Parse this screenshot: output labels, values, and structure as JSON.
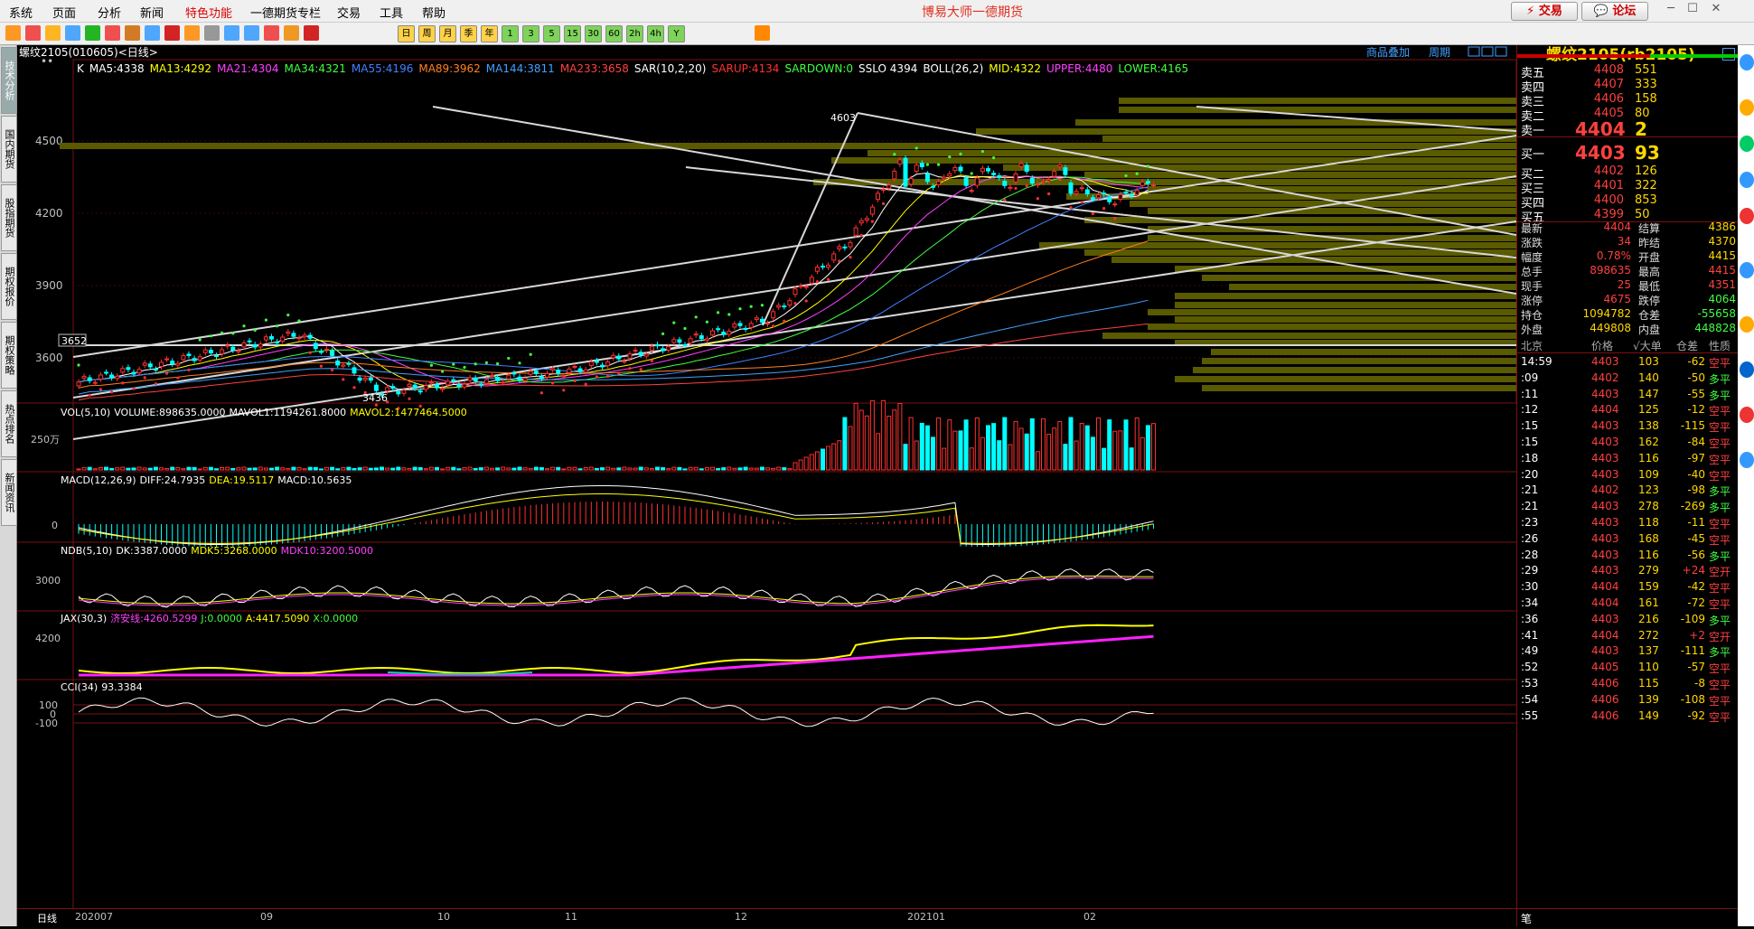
{
  "app": {
    "title": "博易大师一德期货"
  },
  "menu": [
    "系统",
    "页面",
    "分析",
    "新闻",
    "特色功能",
    "一德期货专栏",
    "交易",
    "工具",
    "帮助"
  ],
  "top_buttons": {
    "trade": "交易",
    "forum": "论坛"
  },
  "left_tabs": [
    "技术分析",
    "国内期货",
    "股指期货",
    "期权报价",
    "期权策略",
    "热点排名",
    "新闻资讯"
  ],
  "chart_header": {
    "symbol": "螺纹2105(010605)<日线>",
    "links": [
      "商品叠加",
      "周期"
    ]
  },
  "ma_line": [
    {
      "text": "K",
      "color": "#ffffff"
    },
    {
      "text": "MA5:4338",
      "color": "#ffffff"
    },
    {
      "text": "MA13:4292",
      "color": "#ffff00"
    },
    {
      "text": "MA21:4304",
      "color": "#ff40ff"
    },
    {
      "text": "MA34:4321",
      "color": "#40ff40"
    },
    {
      "text": "MA55:4196",
      "color": "#4080ff"
    },
    {
      "text": "MA89:3962",
      "color": "#ff8020"
    },
    {
      "text": "MA144:3811",
      "color": "#40a0ff"
    },
    {
      "text": "MA233:3658",
      "color": "#ff4040"
    },
    {
      "text": "SAR(10,2,20)",
      "color": "#ffffff"
    },
    {
      "text": "SARUP:4134",
      "color": "#ff3030"
    },
    {
      "text": "SARDOWN:0",
      "color": "#40ff40"
    },
    {
      "text": "SSLO 4394",
      "color": "#ffffff"
    },
    {
      "text": "BOLL(26,2)",
      "color": "#ffffff"
    },
    {
      "text": "MID:4322",
      "color": "#ffff00"
    },
    {
      "text": "UPPER:4480",
      "color": "#ff40ff"
    },
    {
      "text": "LOWER:4165",
      "color": "#40ff40"
    }
  ],
  "price_axis": [
    "4500",
    "4200",
    "3900",
    "3600"
  ],
  "marks": {
    "high": "4603",
    "low": "3436",
    "box": "3652"
  },
  "vol": {
    "label": "VOL(5,10)",
    "volume": "VOLUME:898635.0000",
    "mavol1": "MAVOL1:1194261.8000",
    "mavol2": "MAVOL2:1477464.5000",
    "axis": "250万"
  },
  "macd": {
    "label": "MACD(12,26,9)",
    "diff": "DIFF:24.7935",
    "dea": "DEA:19.5117",
    "macd": "MACD:10.5635",
    "axis": "0"
  },
  "ndb": {
    "label": "NDB(5,10)",
    "dk": "DK:3387.0000",
    "mdk5": "MDK5:3268.0000",
    "mdk10": "MDK10:3200.5000",
    "axis": "3000"
  },
  "jax": {
    "label": "JAX(30,3)",
    "line": "济安线:4260.5299",
    "j": "J:0.0000",
    "a": "A:4417.5090",
    "x": "X:0.0000",
    "axis": "4200"
  },
  "cci": {
    "label": "CCI(34)",
    "value": "93.3384",
    "axis": [
      "100",
      "0",
      "-100"
    ]
  },
  "date_axis": {
    "lead": "日线",
    "dates": [
      "202007",
      "09",
      "10",
      "11",
      "12",
      "202101",
      "02"
    ]
  },
  "quote": {
    "title": "螺纹2105(rb2105)",
    "asks": [
      {
        "label": "卖五",
        "price": "4408",
        "vol": "551"
      },
      {
        "label": "卖四",
        "price": "4407",
        "vol": "333"
      },
      {
        "label": "卖三",
        "price": "4406",
        "vol": "158"
      },
      {
        "label": "卖二",
        "price": "4405",
        "vol": "80"
      },
      {
        "label": "卖一",
        "price": "4404",
        "vol": "2"
      }
    ],
    "bids": [
      {
        "label": "买一",
        "price": "4403",
        "vol": "93"
      },
      {
        "label": "买二",
        "price": "4402",
        "vol": "126"
      },
      {
        "label": "买三",
        "price": "4401",
        "vol": "322"
      },
      {
        "label": "买四",
        "price": "4400",
        "vol": "853"
      },
      {
        "label": "买五",
        "price": "4399",
        "vol": "50"
      }
    ],
    "stats": [
      [
        "最新",
        "4404",
        "结算",
        "4386"
      ],
      [
        "涨跌",
        "34",
        "昨结",
        "4370"
      ],
      [
        "幅度",
        "0.78%",
        "开盘",
        "4415"
      ],
      [
        "总手",
        "898635",
        "最高",
        "4415"
      ],
      [
        "现手",
        "25",
        "最低",
        "4351"
      ],
      [
        "涨停",
        "4675",
        "跌停",
        "4064"
      ],
      [
        "持仓",
        "1094782",
        "仓差",
        "-55658"
      ],
      [
        "外盘",
        "449808",
        "内盘",
        "448828"
      ]
    ],
    "tick_header": [
      "北京",
      "价格",
      "√大单",
      "仓差",
      "性质"
    ],
    "ticks": [
      [
        "14:59",
        "4403",
        "103",
        "-62",
        "空平"
      ],
      [
        ":09",
        "4402",
        "140",
        "-50",
        "多平"
      ],
      [
        ":11",
        "4403",
        "147",
        "-55",
        "多平"
      ],
      [
        ":12",
        "4404",
        "125",
        "-12",
        "空平"
      ],
      [
        ":15",
        "4403",
        "138",
        "-115",
        "空平"
      ],
      [
        ":15",
        "4403",
        "162",
        "-84",
        "空平"
      ],
      [
        ":18",
        "4403",
        "116",
        "-97",
        "空平"
      ],
      [
        ":20",
        "4403",
        "109",
        "-40",
        "空平"
      ],
      [
        ":21",
        "4402",
        "123",
        "-98",
        "多平"
      ],
      [
        ":21",
        "4403",
        "278",
        "-269",
        "多平"
      ],
      [
        ":23",
        "4403",
        "118",
        "-11",
        "空平"
      ],
      [
        ":26",
        "4403",
        "168",
        "-45",
        "空平"
      ],
      [
        ":28",
        "4403",
        "116",
        "-56",
        "多平"
      ],
      [
        ":29",
        "4403",
        "279",
        "+24",
        "空开"
      ],
      [
        ":30",
        "4404",
        "159",
        "-42",
        "空平"
      ],
      [
        ":34",
        "4404",
        "161",
        "-72",
        "空平"
      ],
      [
        ":36",
        "4403",
        "216",
        "-109",
        "多平"
      ],
      [
        ":41",
        "4404",
        "272",
        "+2",
        "空开"
      ],
      [
        ":49",
        "4403",
        "137",
        "-111",
        "多平"
      ],
      [
        ":52",
        "4405",
        "110",
        "-57",
        "空平"
      ],
      [
        ":53",
        "4406",
        "115",
        "-8",
        "空平"
      ],
      [
        ":54",
        "4406",
        "139",
        "-108",
        "空平"
      ],
      [
        ":55",
        "4406",
        "149",
        "-92",
        "空平"
      ]
    ],
    "bottom_tab": "笔"
  },
  "colors": {
    "up": "#ff3030",
    "down": "#00ffff",
    "grid": "#7a1010"
  }
}
